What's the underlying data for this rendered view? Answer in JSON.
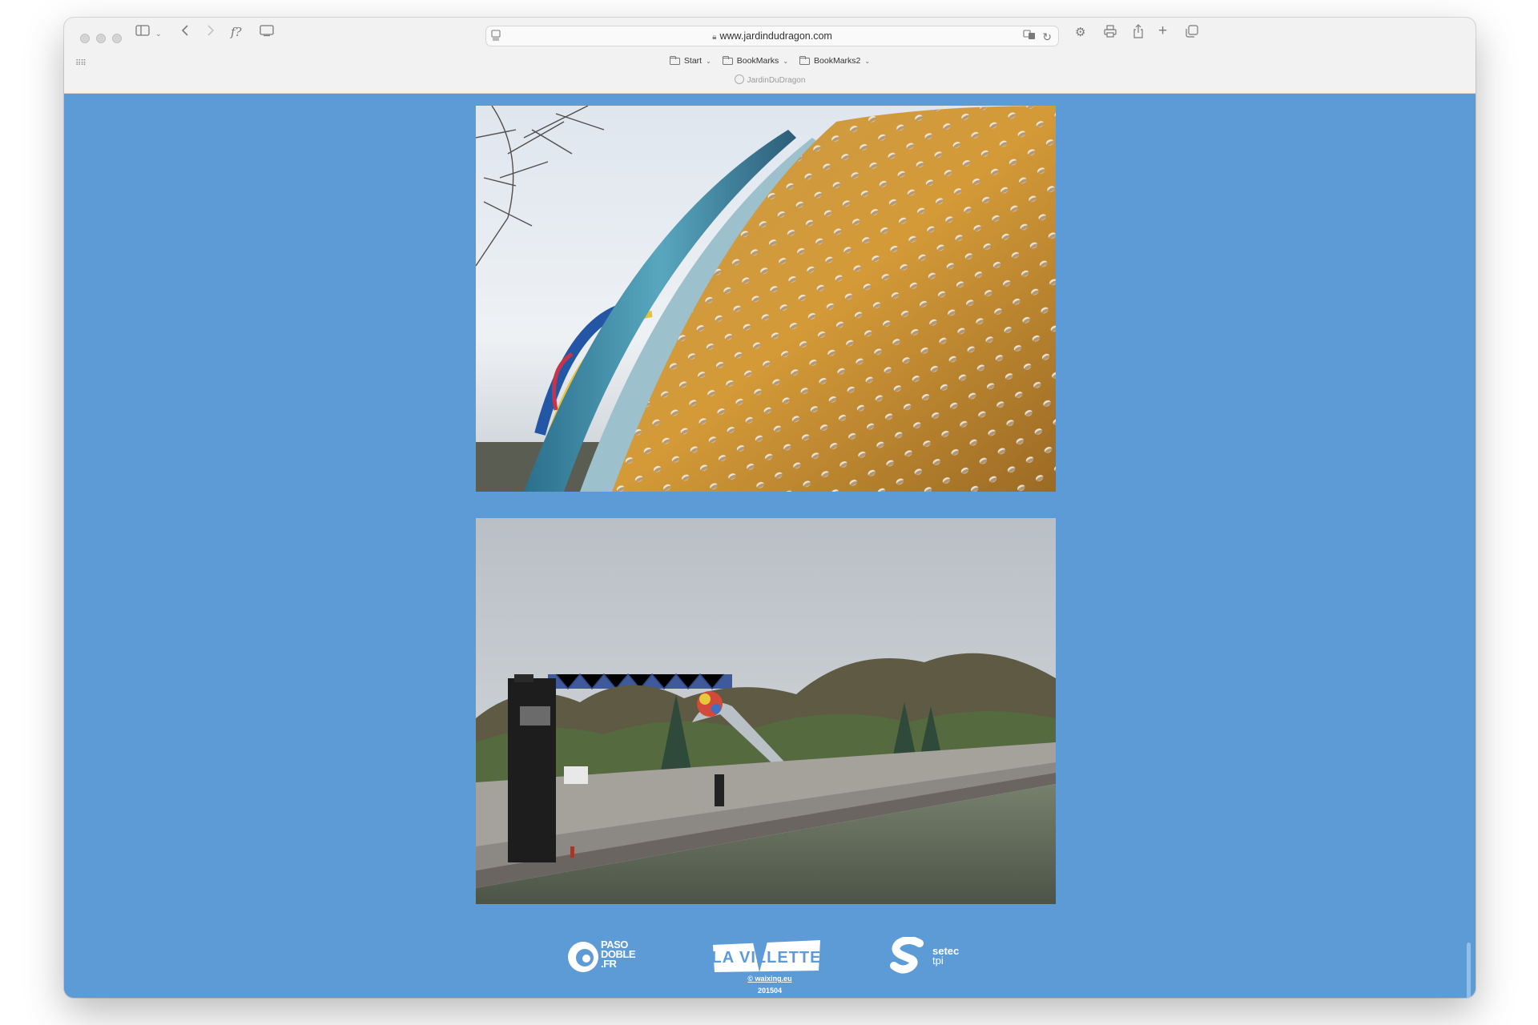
{
  "browser": {
    "url": "www.jardindudragon.com",
    "tab_title": "JardinDuDragon",
    "bookmarks": [
      {
        "label": "Start"
      },
      {
        "label": "BookMarks"
      },
      {
        "label": "BookMarks2"
      }
    ],
    "formula_label": "f?"
  },
  "page": {
    "background": "#5d9bd7",
    "photos": [
      {
        "alt": "Perforated golden dragon sculpture surface with blue curved panels against the sky"
      },
      {
        "alt": "Dragon sculpture in the park viewed across the canal at La Villette"
      }
    ],
    "logos": [
      {
        "name": "pasodoble-logo",
        "line1": "PASO",
        "line2": "DOBLE",
        "line3": ".FR"
      },
      {
        "name": "la-villette-logo",
        "text": "LA VILLETTE"
      },
      {
        "name": "setec-logo",
        "line1": "setec",
        "line2": "tpi"
      }
    ],
    "footer": {
      "credit": "© waixing.eu",
      "date": "201504"
    }
  }
}
